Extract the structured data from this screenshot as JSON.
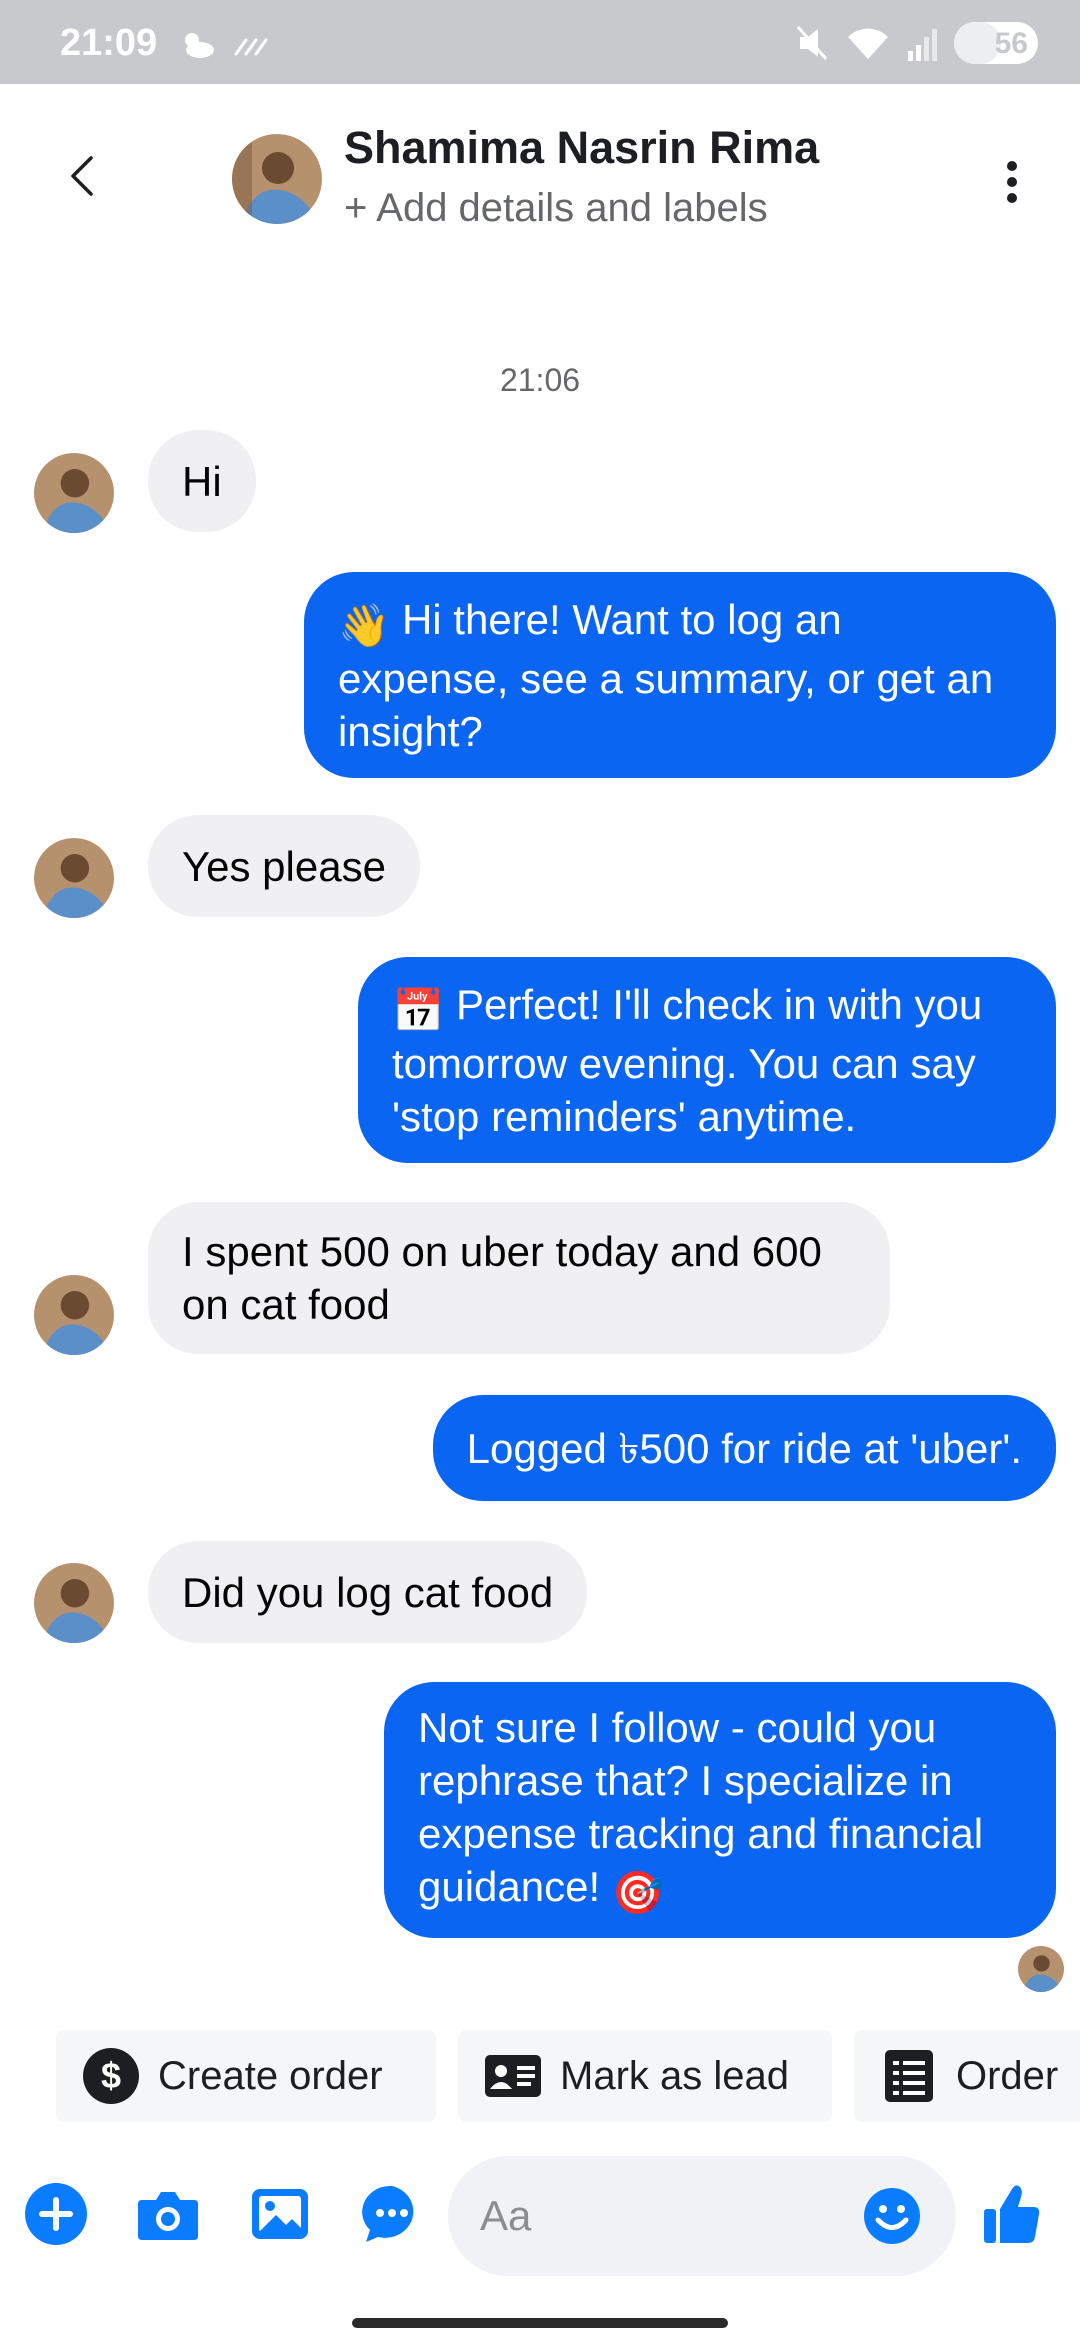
{
  "status_bar": {
    "time": "21:09",
    "battery": "56",
    "battery_fraction": 0.56
  },
  "header": {
    "contact_name": "Shamima Nasrin Rima",
    "subtitle": "+ Add details and labels"
  },
  "conversation": {
    "timestamp": "21:06",
    "messages": [
      {
        "from": "contact",
        "text": "Hi"
      },
      {
        "from": "me",
        "emoji": "👋",
        "text": " Hi there! Want to log an expense, see a summary, or get an insight?"
      },
      {
        "from": "contact",
        "text": "Yes please"
      },
      {
        "from": "me",
        "emoji": "📅",
        "text": " Perfect! I'll check in with you tomorrow evening. You can say 'stop reminders' anytime."
      },
      {
        "from": "contact",
        "text": "I spent 500 on uber today and 600 on cat food"
      },
      {
        "from": "me",
        "text": "Logged ৳500 for ride at 'uber'."
      },
      {
        "from": "contact",
        "text": "Did you log cat food"
      },
      {
        "from": "me",
        "text": "Not sure I follow - could you rephrase that? I specialize in expense tracking and financial guidance! ",
        "emoji_after": "🎯"
      }
    ]
  },
  "quick_actions": [
    {
      "label": "Create order",
      "icon": "dollar-icon"
    },
    {
      "label": "Mark as lead",
      "icon": "contact-card-icon"
    },
    {
      "label": "Order",
      "icon": "receipt-icon"
    }
  ],
  "composer": {
    "placeholder": "Aa"
  },
  "colors": {
    "outgoing_bubble": "#0a66f2",
    "incoming_bubble": "#f0f0f2",
    "accent": "#0a7cff"
  }
}
